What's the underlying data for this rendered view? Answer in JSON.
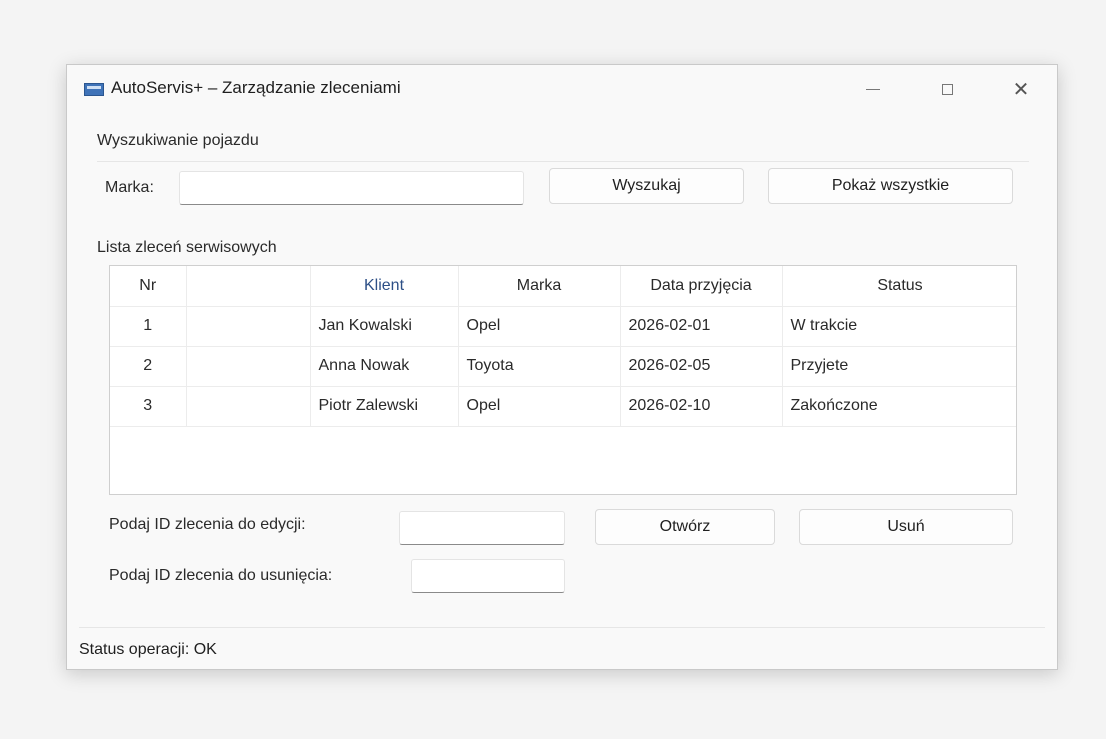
{
  "window": {
    "title": "AutoServis+ – Zarządzanie zleceniami",
    "app_icon": "app-window-icon",
    "controls": {
      "minimize": "minimize-icon",
      "maximize": "maximize-icon",
      "close_glyph": "✕"
    }
  },
  "search": {
    "group_title": "Wyszukiwanie pojazdu",
    "marka_label": "Marka:",
    "marka_value": "",
    "search_button": "Wyszukaj",
    "show_all_button": "Pokaż wszystkie"
  },
  "orders": {
    "group_title": "Lista zleceń serwisowych",
    "columns": [
      "Nr",
      "",
      "Klient",
      "Marka",
      "Data przyjęcia",
      "Status"
    ],
    "rows": [
      [
        "1",
        "",
        "Jan Kowalski",
        "Opel",
        "2026-02-01",
        "W trakcie"
      ],
      [
        "2",
        "",
        "Anna Nowak",
        "Toyota",
        "2026-02-05",
        "Przyjete"
      ],
      [
        "3",
        "",
        "Piotr Zalewski",
        "Opel",
        "2026-02-10",
        "Zakończone"
      ]
    ]
  },
  "edit": {
    "edit_label": "Podaj ID zlecenia do edycji:",
    "edit_value": "",
    "delete_label": "Podaj ID zlecenia do usunięcia:",
    "delete_value": "",
    "open_button": "Otwórz",
    "delete_button": "Usuń"
  },
  "status": {
    "text": "Status operacji: OK"
  },
  "colors": {
    "accent": "#2d4f86",
    "app_icon": "#3f73b8"
  }
}
